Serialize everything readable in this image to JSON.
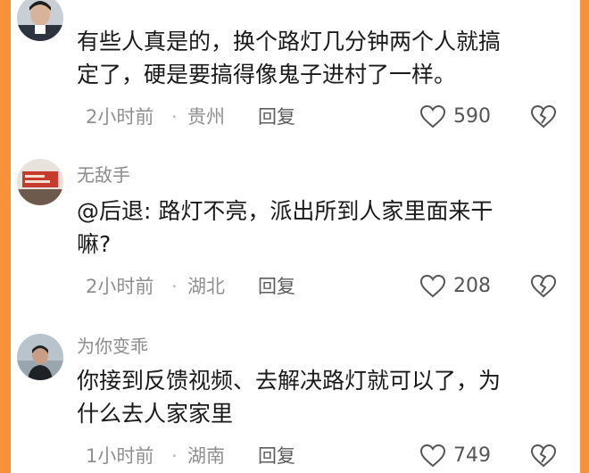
{
  "comments": [
    {
      "username": "",
      "text_line1": "有些人真是的，换个路灯几分钟两个人就搞",
      "text_line2": "定了，硬是要搞得像鬼子进村了一样。",
      "time": "2小时前",
      "dot": "·",
      "location": "贵州",
      "reply_label": "回复",
      "likes": "590"
    },
    {
      "username": "无敌手",
      "text_line1": "@后退: 路灯不亮，派出所到人家里面来干",
      "text_line2": "嘛?",
      "time": "2小时前",
      "dot": "·",
      "location": "湖北",
      "reply_label": "回复",
      "likes": "208"
    },
    {
      "username": "为你变乖",
      "text_line1": "你接到反馈视频、去解决路灯就可以了，为",
      "text_line2": "什么去人家家里",
      "time": "1小时前",
      "dot": "·",
      "location": "湖南",
      "reply_label": "回复",
      "likes": "749"
    }
  ],
  "icons": {
    "like": "heart-outline-icon",
    "dislike": "broken-heart-icon"
  },
  "colors": {
    "frame": "#f7923a",
    "text": "#1a1a1a",
    "meta": "#8f8f8f"
  }
}
